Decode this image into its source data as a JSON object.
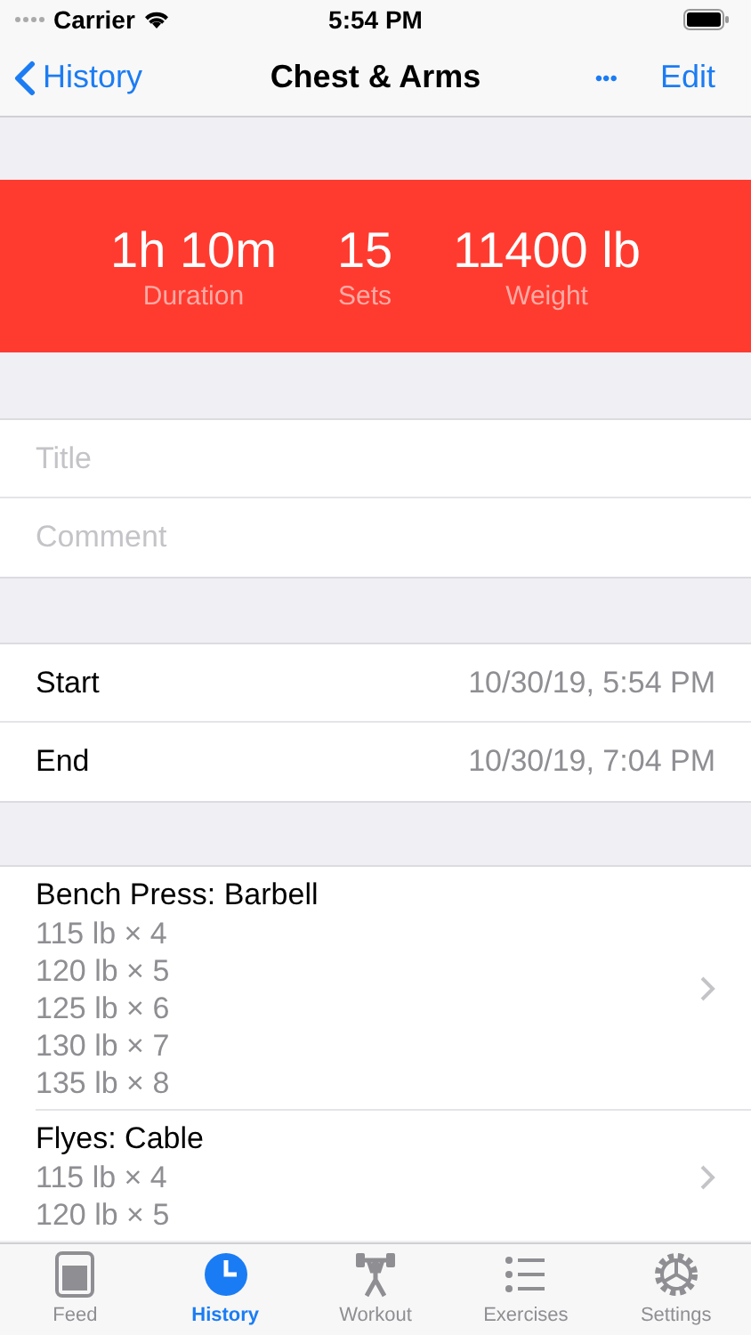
{
  "status_bar": {
    "carrier": "Carrier",
    "time": "5:54 PM"
  },
  "nav": {
    "back": "History",
    "title": "Chest & Arms",
    "more": "•••",
    "edit": "Edit"
  },
  "summary": [
    {
      "value": "1h 10m",
      "label": "Duration"
    },
    {
      "value": "15",
      "label": "Sets"
    },
    {
      "value": "11400 lb",
      "label": "Weight"
    }
  ],
  "fields": [
    {
      "placeholder": "Title"
    },
    {
      "placeholder": "Comment"
    }
  ],
  "times": [
    {
      "label": "Start",
      "value": "10/30/19, 5:54 PM"
    },
    {
      "label": "End",
      "value": "10/30/19, 7:04 PM"
    }
  ],
  "exercises": [
    {
      "name": "Bench Press: Barbell",
      "sets": [
        "115 lb × 4",
        "120 lb × 5",
        "125 lb × 6",
        "130 lb × 7",
        "135 lb × 8"
      ]
    },
    {
      "name": "Flyes: Cable",
      "sets": [
        "115 lb × 4",
        "120 lb × 5"
      ]
    }
  ],
  "tab_bar": [
    {
      "label": "Feed",
      "kind": "feed",
      "selected": false
    },
    {
      "label": "History",
      "kind": "history",
      "selected": true
    },
    {
      "label": "Workout",
      "kind": "workout",
      "selected": false
    },
    {
      "label": "Exercises",
      "kind": "exercises",
      "selected": false
    },
    {
      "label": "Settings",
      "kind": "settings",
      "selected": false
    }
  ]
}
